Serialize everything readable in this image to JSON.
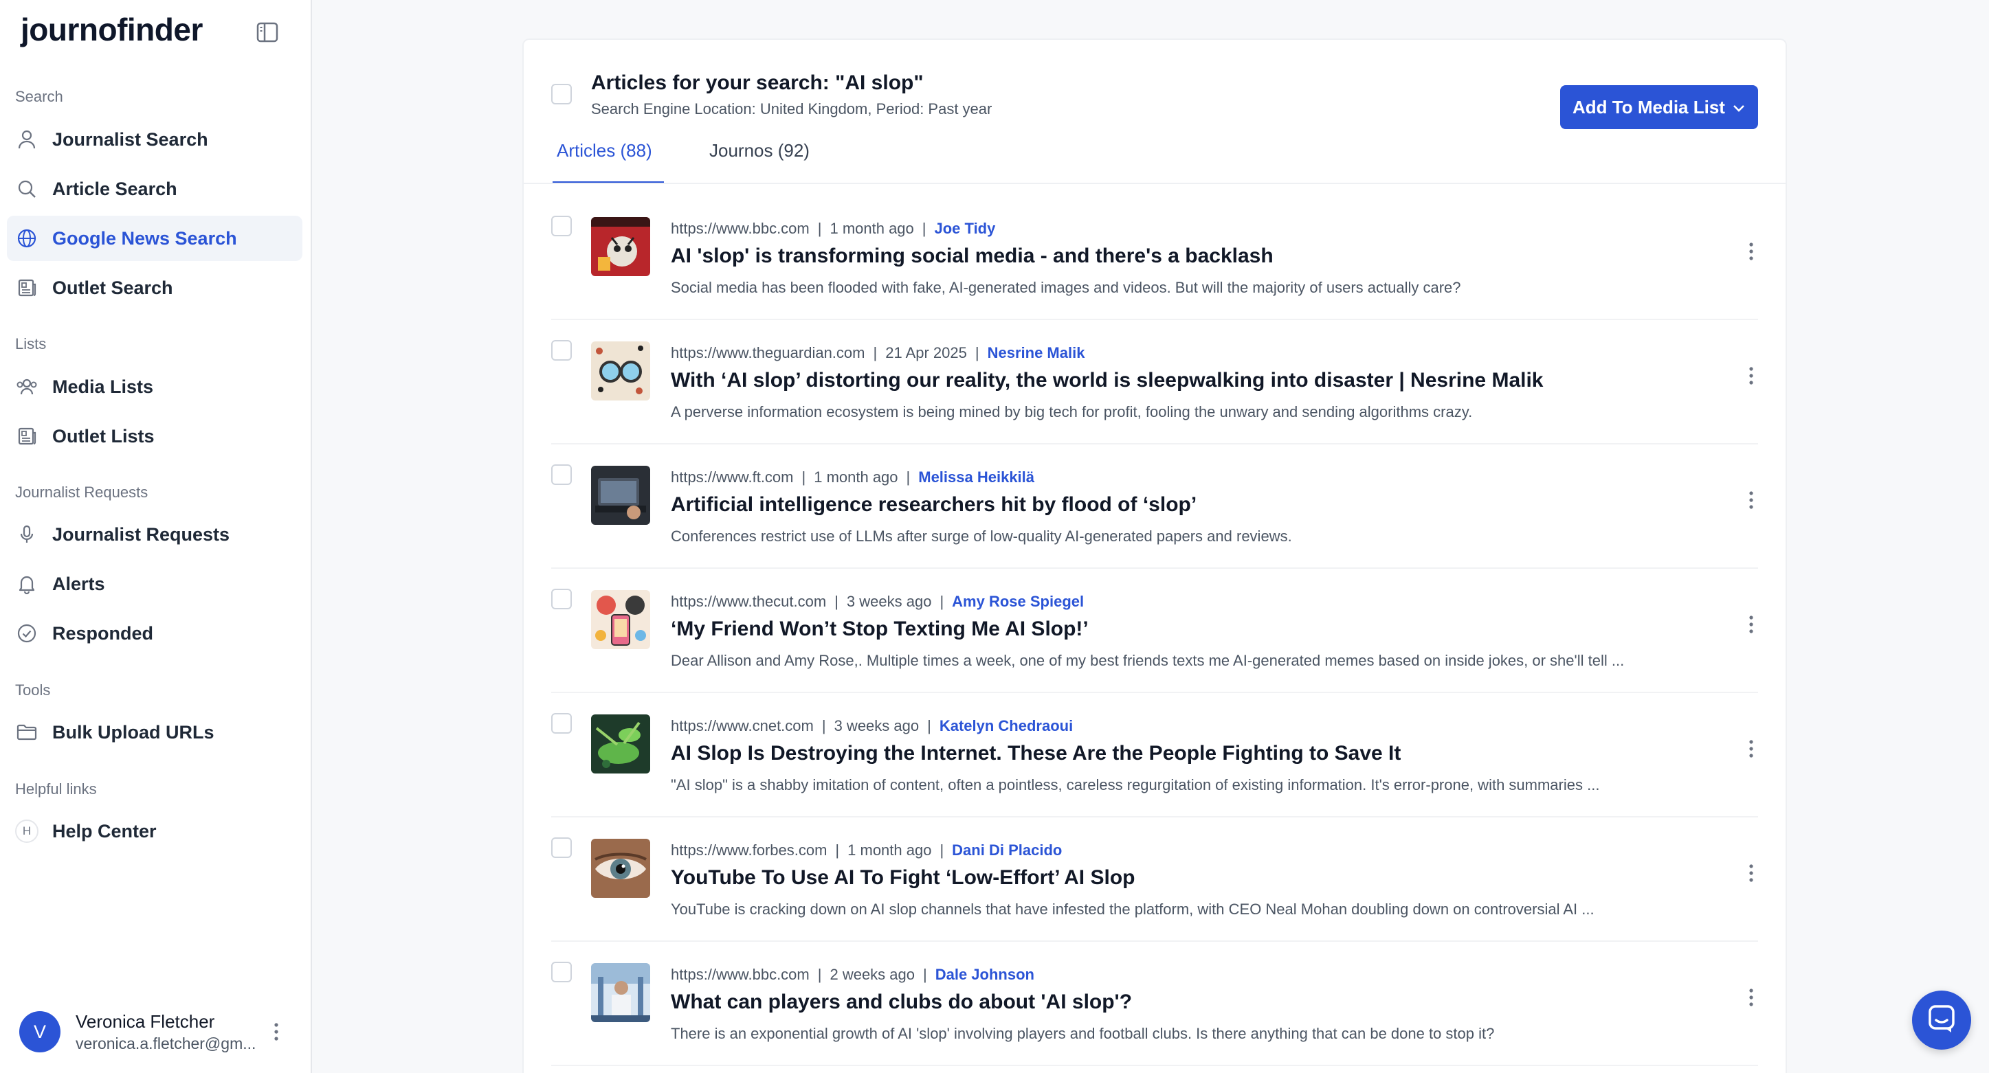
{
  "app": {
    "brand": "journofinder"
  },
  "sidebar": {
    "sections": {
      "search": "Search",
      "lists": "Lists",
      "journalist_requests": "Journalist Requests",
      "tools": "Tools",
      "helpful_links": "Helpful links"
    },
    "items": {
      "journalist_search": {
        "label": "Journalist Search",
        "icon": "user-icon"
      },
      "article_search": {
        "label": "Article Search",
        "icon": "search-icon"
      },
      "google_news_search": {
        "label": "Google News Search",
        "icon": "globe-icon",
        "active": true
      },
      "outlet_search": {
        "label": "Outlet Search",
        "icon": "newspaper-icon"
      },
      "media_lists": {
        "label": "Media Lists",
        "icon": "users-icon"
      },
      "outlet_lists": {
        "label": "Outlet Lists",
        "icon": "newspaper-icon"
      },
      "journalist_requests": {
        "label": "Journalist Requests",
        "icon": "microphone-icon"
      },
      "alerts": {
        "label": "Alerts",
        "icon": "bell-icon"
      },
      "responded": {
        "label": "Responded",
        "icon": "check-circle-icon"
      },
      "bulk_upload": {
        "label": "Bulk Upload URLs",
        "icon": "folder-icon"
      },
      "help_center": {
        "label": "Help Center",
        "icon": "help-badge-icon",
        "badge": "H"
      }
    },
    "user": {
      "initial": "V",
      "name": "Veronica Fletcher",
      "email": "veronica.a.fletcher@gm..."
    }
  },
  "main": {
    "title": "Articles for your search: \"AI slop\"",
    "subtitle": "Search Engine Location: United Kingdom, Period: Past year",
    "add_button": "Add To Media List",
    "tabs": [
      {
        "label": "Articles (88)",
        "active": true
      },
      {
        "label": "Journos (92)",
        "active": false
      }
    ],
    "articles": [
      {
        "url": "https://www.bbc.com",
        "date": "1 month ago",
        "author": "Joe Tidy",
        "title": "AI 'slop' is transforming social media - and there's a backlash",
        "snippet": "Social media has been flooded with fake, AI-generated images and videos. But will the majority of users actually care?"
      },
      {
        "url": "https://www.theguardian.com",
        "date": "21 Apr 2025",
        "author": "Nesrine Malik",
        "title": "With ‘AI slop’ distorting our reality, the world is sleepwalking into disaster | Nesrine Malik",
        "snippet": "A perverse information ecosystem is being mined by big tech for profit, fooling the unwary and sending algorithms crazy."
      },
      {
        "url": "https://www.ft.com",
        "date": "1 month ago",
        "author": "Melissa Heikkilä",
        "title": "Artificial intelligence researchers hit by flood of ‘slop’",
        "snippet": "Conferences restrict use of LLMs after surge of low-quality AI-generated papers and reviews."
      },
      {
        "url": "https://www.thecut.com",
        "date": "3 weeks ago",
        "author": "Amy Rose Spiegel",
        "title": "‘My Friend Won’t Stop Texting Me AI Slop!’",
        "snippet": "Dear Allison and Amy Rose,. Multiple times a week, one of my best friends texts me AI-generated memes based on inside jokes, or she'll tell ..."
      },
      {
        "url": "https://www.cnet.com",
        "date": "3 weeks ago",
        "author": "Katelyn Chedraoui",
        "title": "AI Slop Is Destroying the Internet. These Are the People Fighting to Save It",
        "snippet": "\"AI slop\" is a shabby imitation of content, often a pointless, careless regurgitation of existing information. It's error-prone, with summaries ..."
      },
      {
        "url": "https://www.forbes.com",
        "date": "1 month ago",
        "author": "Dani Di Placido",
        "title": "YouTube To Use AI To Fight ‘Low-Effort’ AI Slop",
        "snippet": "YouTube is cracking down on AI slop channels that have infested the platform, with CEO Neal Mohan doubling down on controversial AI ..."
      },
      {
        "url": "https://www.bbc.com",
        "date": "2 weeks ago",
        "author": "Dale Johnson",
        "title": "What can players and clubs do about 'AI slop'?",
        "snippet": "There is an exponential growth of AI 'slop' involving players and football clubs. Is there anything that can be done to stop it?"
      }
    ]
  },
  "colors": {
    "accent": "#2b54d6",
    "text": "#111827",
    "muted": "#4b5563",
    "background": "#f7f8fa"
  }
}
